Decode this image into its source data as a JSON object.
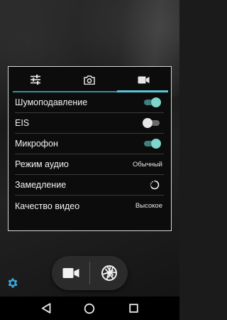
{
  "tabs": [
    {
      "name": "settings",
      "icon": "sliders-icon",
      "active": false
    },
    {
      "name": "photo",
      "icon": "camera-icon",
      "active": false
    },
    {
      "name": "video",
      "icon": "video-camera-icon",
      "active": true
    }
  ],
  "settings": [
    {
      "label": "Шумоподавление",
      "control": "switch",
      "on": true
    },
    {
      "label": "EIS",
      "control": "switch",
      "on": false
    },
    {
      "label": "Микрофон",
      "control": "switch",
      "on": true
    },
    {
      "label": "Режим аудио",
      "control": "value",
      "value": "Обычный"
    },
    {
      "label": "Замедление",
      "control": "spinner"
    },
    {
      "label": "Качество видео",
      "control": "value",
      "value": "Высокое"
    }
  ],
  "capture": {
    "video_icon": "video-camera-icon",
    "photo_icon": "shutter-icon"
  },
  "settings_icon": "gear-icon",
  "navbar": {
    "back_icon": "back-triangle-icon",
    "home_icon": "home-circle-icon",
    "recents_icon": "recents-square-icon"
  },
  "colors": {
    "accent": "#57c6d7",
    "switch_on_thumb": "#7fd4cc",
    "switch_on_track": "#3f7f7e",
    "gear": "#3ba4d8",
    "panel_border": "#d8d8d8"
  }
}
